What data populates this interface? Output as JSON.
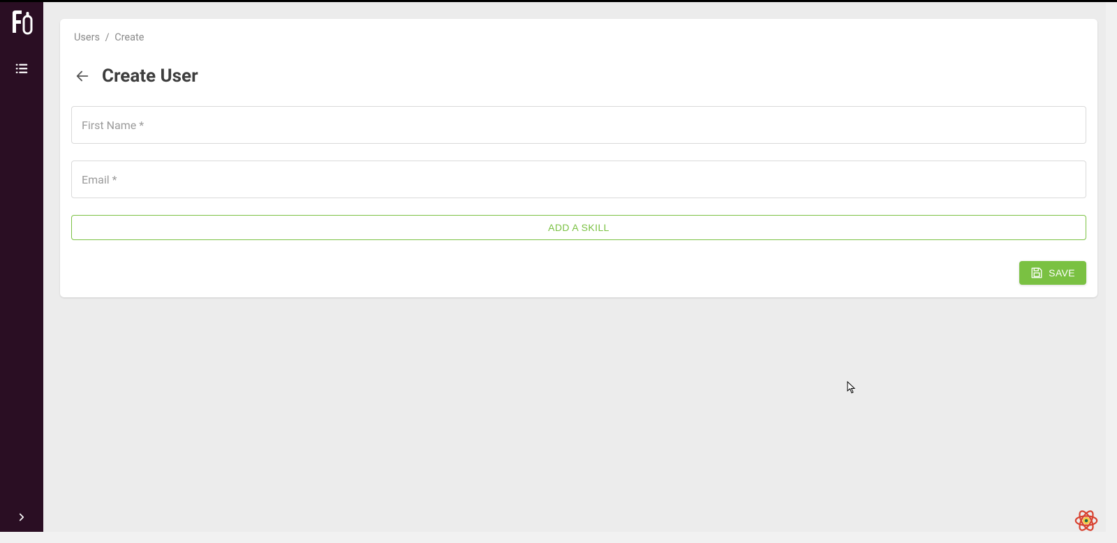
{
  "breadcrumb": {
    "root": "Users",
    "separator": "/",
    "current": "Create"
  },
  "page": {
    "title": "Create User"
  },
  "form": {
    "first_name_label": "First Name *",
    "first_name_value": "",
    "email_label": "Email *",
    "email_value": "",
    "add_skill_label": "ADD A SKILL"
  },
  "actions": {
    "save_label": "SAVE"
  },
  "icons": {
    "logo": "logo-fo",
    "menu": "list-icon",
    "expand": "chevron-right-icon",
    "back": "arrow-left-icon",
    "save": "save-icon",
    "badge": "react-query-icon"
  }
}
